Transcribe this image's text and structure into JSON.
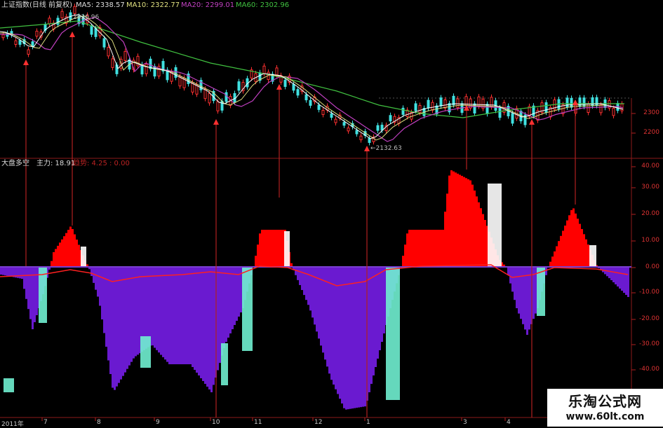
{
  "top_panel": {
    "title": "上证指数(日线 前复权)",
    "ma5_label": "MA5: 2338.57",
    "ma10_label": "MA10: 2322.77",
    "ma20_label": "MA20: 2299.01",
    "ma60_label": "MA60: 2302.96",
    "high_label": "2826.96",
    "low_label": "←2132.63",
    "axis_labels": [
      "2300",
      "2200"
    ],
    "colors": {
      "ma5": "#ffffff",
      "ma10": "#e0e080",
      "ma20": "#c040c0",
      "ma60": "#40c040",
      "up": "#ff2020",
      "down": "#40e0e0"
    }
  },
  "bottom_panel": {
    "title": "大盘多空",
    "main_label": "主力: 18.91",
    "trend_label": "趋势: 4.25 : 0.00",
    "axis_labels": [
      "40.00",
      "30.00",
      "20.00",
      "10.00",
      "0.00",
      "-10.00",
      "-20.00",
      "-30.00",
      "-40.00"
    ],
    "colors": {
      "positive": "#ff0000",
      "negative": "#6a1ad0",
      "edge_pos": "#ffffff",
      "edge_neg": "#70f0d0",
      "line": "#ff2020"
    }
  },
  "x_axis": {
    "labels": [
      "2011年",
      "7",
      "8",
      "9",
      "10",
      "11",
      "12",
      "1",
      "3",
      "4"
    ]
  },
  "watermark": {
    "line1": "乐淘公式网",
    "line2": "www.60lt.com"
  }
}
